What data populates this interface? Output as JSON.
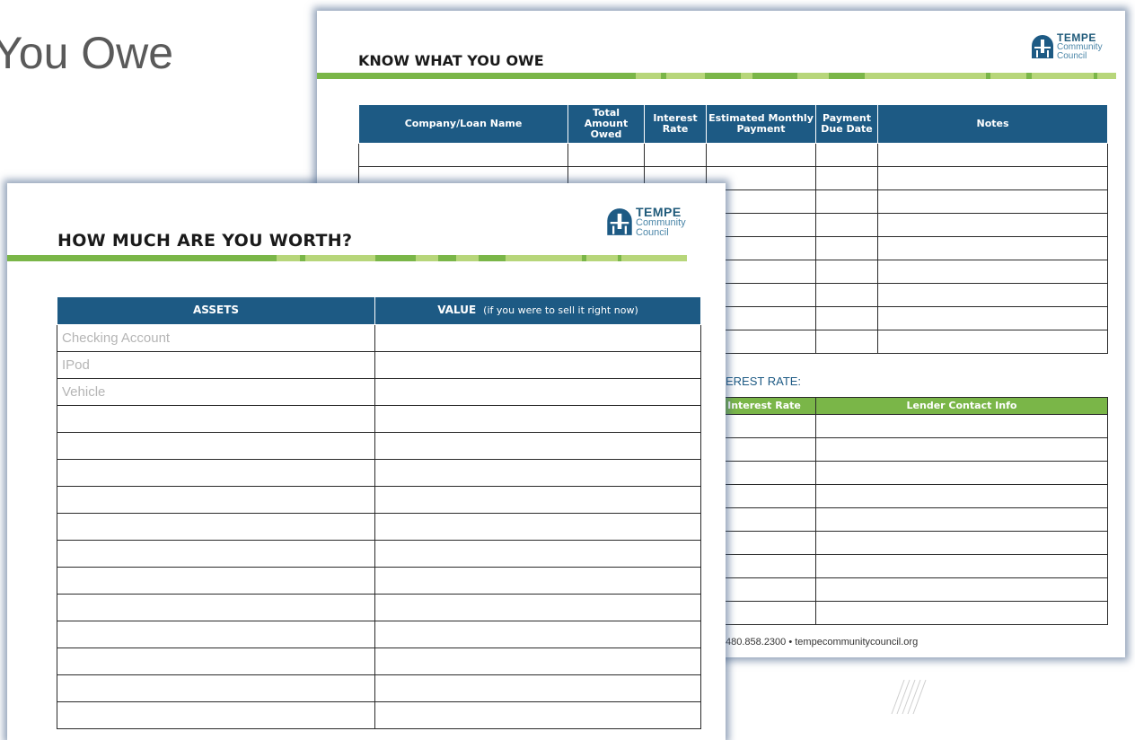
{
  "slide": {
    "title": "You Owe"
  },
  "owe_sheet": {
    "heading": "KNOW WHAT YOU OWE",
    "logo": {
      "line1": "TEMPE",
      "line2": "Community",
      "line3": "Council"
    },
    "columns": [
      "Company/Loan Name",
      "Total Amount Owed",
      "Interest Rate",
      "Estimated Monthly Payment",
      "Payment Due Date",
      "Notes"
    ],
    "rows": [
      [
        "",
        "",
        "",
        "",
        "",
        ""
      ],
      [
        "",
        "",
        "",
        "",
        "",
        ""
      ],
      [
        "",
        "",
        "",
        "",
        "",
        ""
      ],
      [
        "",
        "",
        "",
        "",
        "",
        ""
      ],
      [
        "",
        "",
        "",
        "",
        "",
        ""
      ],
      [
        "",
        "",
        "",
        "",
        "",
        ""
      ],
      [
        "",
        "",
        "",
        "",
        "",
        ""
      ],
      [
        "",
        "",
        "",
        "",
        "",
        ""
      ],
      [
        "",
        "",
        "",
        "",
        "",
        ""
      ]
    ],
    "rate_heading": "EREST RATE:",
    "lender_columns": [
      "Interest Rate",
      "Lender Contact Info"
    ],
    "lender_rows": [
      [
        "",
        ""
      ],
      [
        "",
        ""
      ],
      [
        "",
        ""
      ],
      [
        "",
        ""
      ],
      [
        "",
        ""
      ],
      [
        "",
        ""
      ],
      [
        "",
        ""
      ],
      [
        "",
        ""
      ],
      [
        "",
        ""
      ]
    ],
    "footer": "480.858.2300 • tempecommunitycouncil.org"
  },
  "worth_sheet": {
    "heading": "HOW MUCH ARE YOU WORTH?",
    "logo": {
      "line1": "TEMPE",
      "line2": "Community",
      "line3": "Council"
    },
    "columns": {
      "assets": "ASSETS",
      "value": "VALUE",
      "value_note": "(if you were to sell it right now)"
    },
    "rows": [
      [
        "Checking Account",
        ""
      ],
      [
        "IPod",
        ""
      ],
      [
        "Vehicle",
        ""
      ],
      [
        "",
        ""
      ],
      [
        "",
        ""
      ],
      [
        "",
        ""
      ],
      [
        "",
        ""
      ],
      [
        "",
        ""
      ],
      [
        "",
        ""
      ],
      [
        "",
        ""
      ],
      [
        "",
        ""
      ],
      [
        "",
        ""
      ],
      [
        "",
        ""
      ],
      [
        "",
        ""
      ],
      [
        "",
        ""
      ]
    ]
  },
  "colors": {
    "header_blue": "#1d5a84",
    "accent_green": "#7ab648",
    "light_green": "#b7d67a"
  }
}
